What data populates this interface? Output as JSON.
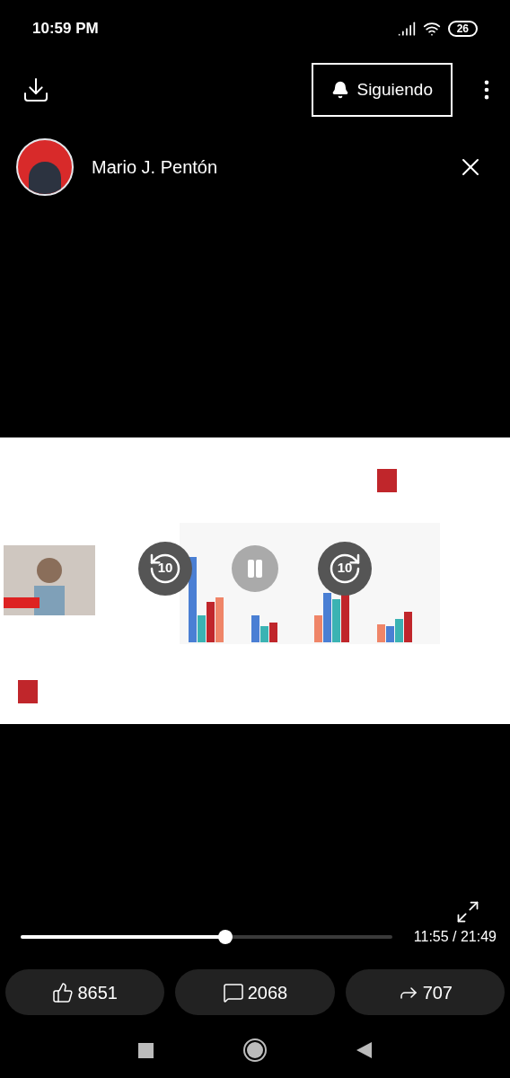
{
  "status_bar": {
    "time": "10:59 PM",
    "battery": "26"
  },
  "top_bar": {
    "follow_button": {
      "label": "Siguiendo"
    }
  },
  "author": {
    "name": "Mario J. Pentón"
  },
  "video": {
    "kind": "picture",
    "rewind": {
      "label": "10"
    },
    "forward": {
      "label": "10"
    }
  },
  "seek_bar": {
    "level": 0.55,
    "time": "11:55 / 21:49"
  },
  "actions": [
    {
      "kind": "like",
      "count": "8651"
    },
    {
      "kind": "comment",
      "count": "2068"
    },
    {
      "kind": "share",
      "count": "707"
    }
  ]
}
